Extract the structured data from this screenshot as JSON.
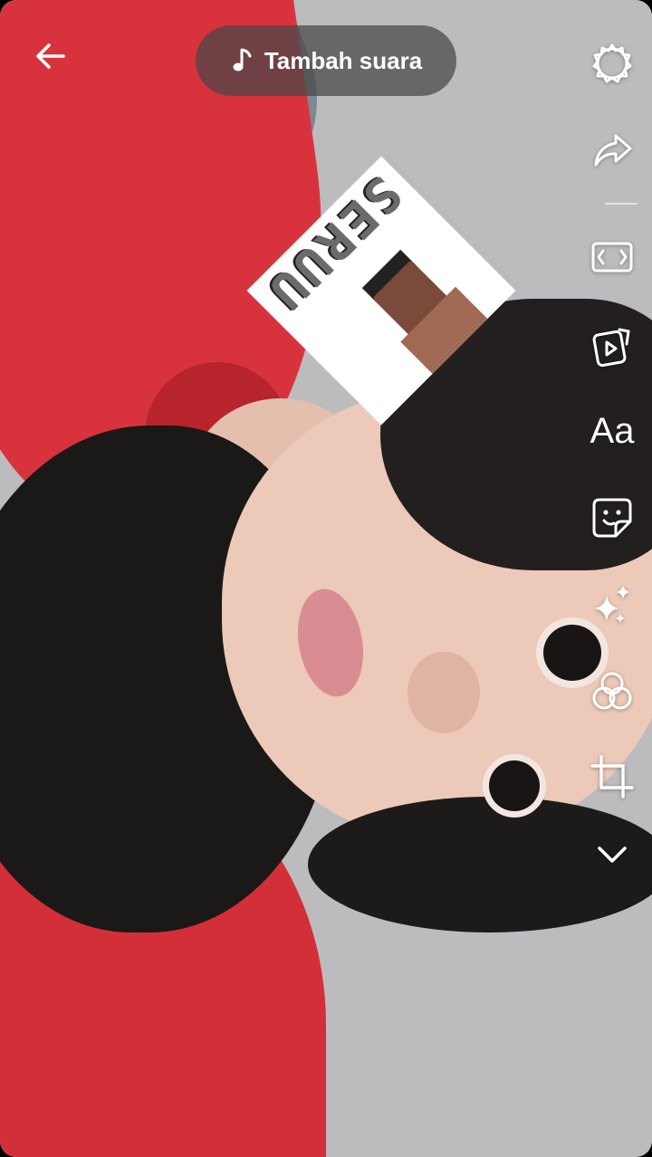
{
  "top_bar": {
    "back_icon": "arrow-left-icon",
    "sound": {
      "icon": "music-note-icon",
      "label": "Tambah suara"
    }
  },
  "sticker": {
    "text": "SERUU"
  },
  "toolbar": {
    "items": [
      {
        "name": "settings",
        "icon": "gear-icon"
      },
      {
        "name": "share",
        "icon": "share-arrow-icon"
      },
      {
        "name": "aspect",
        "icon": "aspect-ratio-icon"
      },
      {
        "name": "video",
        "icon": "video-clip-icon"
      },
      {
        "name": "text",
        "label": "Aa"
      },
      {
        "name": "sticker",
        "icon": "sticker-icon"
      },
      {
        "name": "effects",
        "icon": "sparkle-icon"
      },
      {
        "name": "filters",
        "icon": "filter-circles-icon"
      },
      {
        "name": "crop",
        "icon": "crop-icon"
      },
      {
        "name": "more",
        "icon": "chevron-down-icon"
      }
    ]
  },
  "colors": {
    "pill_bg": "#464648",
    "icon": "#ffffff"
  }
}
